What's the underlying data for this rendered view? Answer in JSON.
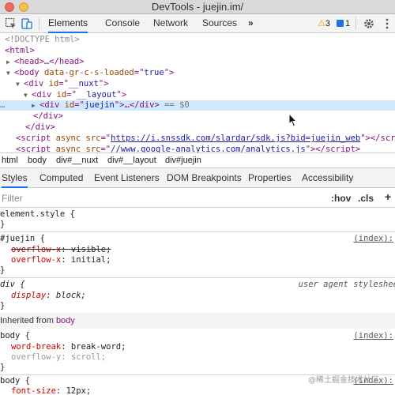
{
  "window": {
    "title": "DevTools - juejin.im/"
  },
  "toolbar": {
    "tabs": [
      "Elements",
      "Console",
      "Network",
      "Sources"
    ],
    "more": "»",
    "warnings": "3",
    "messages": "1",
    "icons": [
      "inspect-icon",
      "device-toggle-icon",
      "gear-icon",
      "kebab-menu-icon"
    ]
  },
  "dom": {
    "doctype": "<!DOCTYPE html>",
    "html_open": "<html>",
    "head": "<head>…</head>",
    "body_tag": "body",
    "body_attr": "data-gr-c-s-loaded",
    "body_val": "true",
    "nuxt_tag": "div",
    "nuxt_attr": "id",
    "nuxt_val": "__nuxt",
    "layout_val": "__layout",
    "juejin_val": "juejin",
    "juejin_tail": "…</div>",
    "juejin_eq": "== $0",
    "div_close": "</div>",
    "script1_attr_async": "async",
    "script1_src": "https://i.snssdk.com/slardar/sdk.js?bid=juejin_web",
    "script2_src": "//www.google-analytics.com/analytics.js"
  },
  "breadcrumb": [
    "html",
    "body",
    "div#__nuxt",
    "div#__layout",
    "div#juejin"
  ],
  "subtabs": [
    "Styles",
    "Computed",
    "Event Listeners",
    "DOM Breakpoints",
    "Properties",
    "Accessibility"
  ],
  "filter": {
    "placeholder": "Filter",
    "hov": ":hov",
    "cls": ".cls",
    "plus": "+"
  },
  "styles": {
    "element_style": "element.style {",
    "close": "}",
    "rule1_selector": "#juejin {",
    "rule1_source": "(index):",
    "rule1_p1_name": "overflow-x",
    "rule1_p1_val": "visible;",
    "rule1_p2_name": "overflow-x",
    "rule1_p2_val": "initial;",
    "rule2_selector": "div {",
    "rule2_source": "user agent styleshee",
    "rule2_p1_name": "display",
    "rule2_p1_val": "block;",
    "inherited_label": "Inherited from",
    "inherited_from": "body",
    "rule3_selector": "body {",
    "rule3_source": "(index):",
    "rule3_p1_name": "word-break",
    "rule3_p1_val": "break-word;",
    "rule3_p2_name": "overflow-y",
    "rule3_p2_val": "scroll;",
    "rule4_selector": "body {",
    "rule4_source": "(index):",
    "rule4_p1_name": "font-size",
    "rule4_p1_val": "12px;"
  },
  "watermark": "@稀土掘金技术社区"
}
